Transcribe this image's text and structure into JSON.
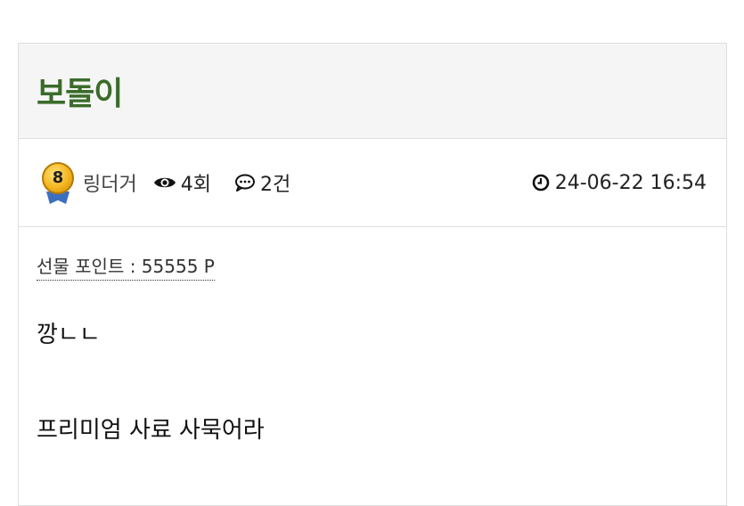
{
  "post": {
    "title": "보돌이",
    "author": "링더거",
    "level": "8",
    "views": "4회",
    "comments": "2건",
    "date": "24-06-22 16:54"
  },
  "icons": {
    "level": "level-badge-icon",
    "views": "eye-icon",
    "comments": "comment-icon",
    "date": "clock-icon"
  },
  "content": {
    "points_label": "선물 포인트 : 55555 P",
    "lines": [
      "깡ㄴㄴ",
      "프리미엄 사료 사묵어라"
    ]
  },
  "colors": {
    "title": "#3a6b2a",
    "header_bg": "#f5f5f5",
    "border": "#dedede"
  }
}
